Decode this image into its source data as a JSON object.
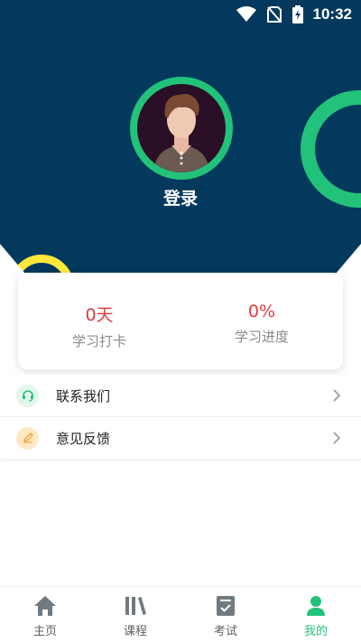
{
  "status_bar": {
    "time": "10:32"
  },
  "profile": {
    "login_label": "登录"
  },
  "stats": [
    {
      "value": "0天",
      "label": "学习打卡"
    },
    {
      "value": "0%",
      "label": "学习进度"
    }
  ],
  "menu": [
    {
      "label": "联系我们",
      "icon": "headset-icon"
    },
    {
      "label": "意见反馈",
      "icon": "feedback-pen-icon"
    }
  ],
  "tabbar": [
    {
      "label": "主页",
      "icon": "home-icon"
    },
    {
      "label": "课程",
      "icon": "books-icon"
    },
    {
      "label": "考试",
      "icon": "exam-clipboard-icon"
    },
    {
      "label": "我的",
      "icon": "user-icon",
      "active": true
    }
  ],
  "colors": {
    "header_bg": "#04395e",
    "accent": "#23c27a",
    "stat_value": "#e23b3b",
    "ring_yellow": "#ffe83a"
  }
}
